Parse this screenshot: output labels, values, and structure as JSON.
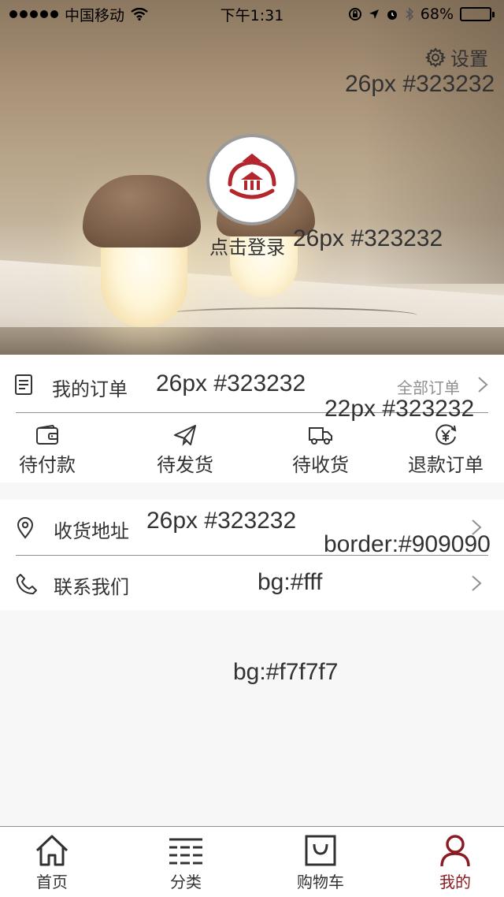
{
  "status_bar": {
    "carrier": "中国移动",
    "time": "下午1:31",
    "battery": "68%",
    "battery_level": 0.68
  },
  "header": {
    "settings_label": "设置",
    "login_label": "点击登录"
  },
  "orders": {
    "title": "我的订单",
    "all_orders": "全部订单",
    "statuses": [
      {
        "label": "待付款",
        "icon": "wallet-icon"
      },
      {
        "label": "待发货",
        "icon": "paper-plane-icon"
      },
      {
        "label": "待收货",
        "icon": "truck-icon"
      },
      {
        "label": "退款订单",
        "icon": "refund-yen-icon"
      }
    ]
  },
  "menu": {
    "address": "收货地址",
    "contact": "联系我们"
  },
  "tabbar": {
    "items": [
      {
        "label": "首页",
        "icon": "home-icon"
      },
      {
        "label": "分类",
        "icon": "category-icon"
      },
      {
        "label": "购物车",
        "icon": "shopping-bag-icon"
      },
      {
        "label": "我的",
        "icon": "user-icon",
        "active": true
      }
    ]
  },
  "annotations": {
    "settings_spec": "26px #323232",
    "login_spec": "26px #323232",
    "orders_spec": "26px #323232",
    "all_orders_spec": "22px #323232",
    "address_spec": "26px #323232",
    "border_spec": "border:#909090",
    "bg_white_spec": "bg:#fff",
    "bg_page_spec": "bg:#f7f7f7"
  },
  "colors": {
    "text": "#323232",
    "border": "#909090",
    "page_bg": "#f7f7f7",
    "card_bg": "#fff",
    "accent": "#8b1a22",
    "logo_red": "#b3262d"
  }
}
